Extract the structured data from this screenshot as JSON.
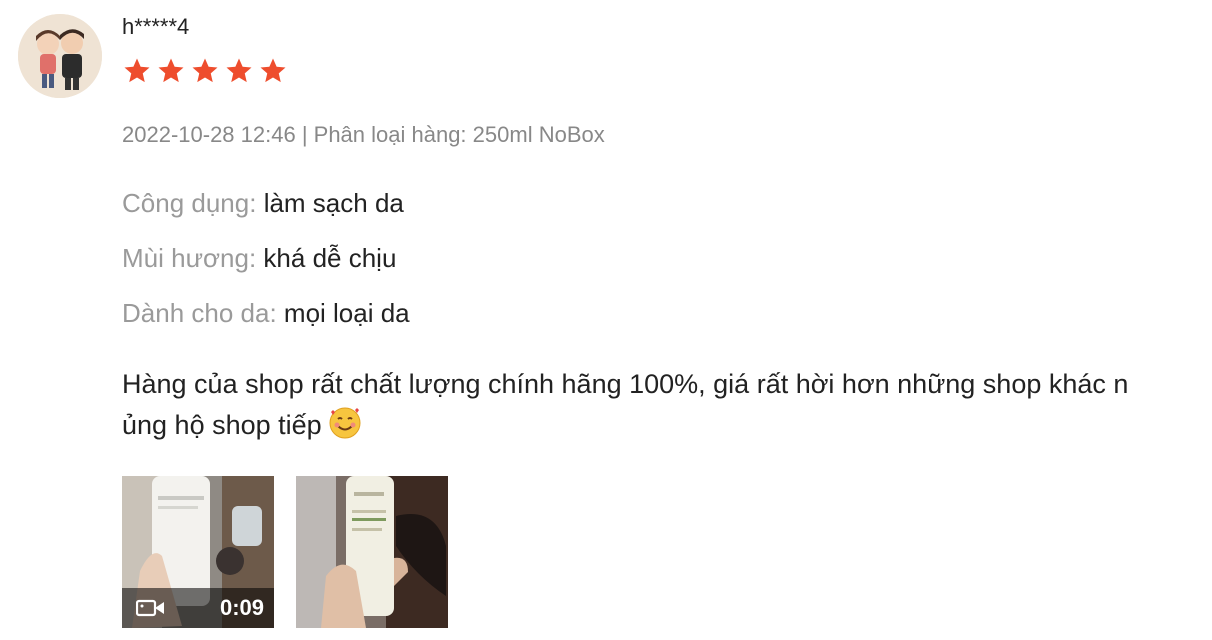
{
  "review": {
    "username": "h*****4",
    "rating": 5,
    "max_rating": 5,
    "star_color": "#ee4d2d",
    "meta": "2022-10-28 12:46 | Phân loại hàng: 250ml NoBox",
    "attributes": [
      {
        "label": "Công dụng:",
        "value": "làm sạch da"
      },
      {
        "label": "Mùi hương:",
        "value": "khá dễ chịu"
      },
      {
        "label": "Dành cho da:",
        "value": "mọi loại da"
      }
    ],
    "comment_line1": "Hàng của shop rất chất lượng chính hãng 100%, giá rất hời hơn những shop khác n",
    "comment_line2": "ủng hộ  shop tiếp",
    "comment_emoji": "smiling-face-with-hearts-icon",
    "media": [
      {
        "type": "video",
        "duration": "0:09",
        "icon": "video-camera-icon"
      },
      {
        "type": "image"
      }
    ]
  }
}
